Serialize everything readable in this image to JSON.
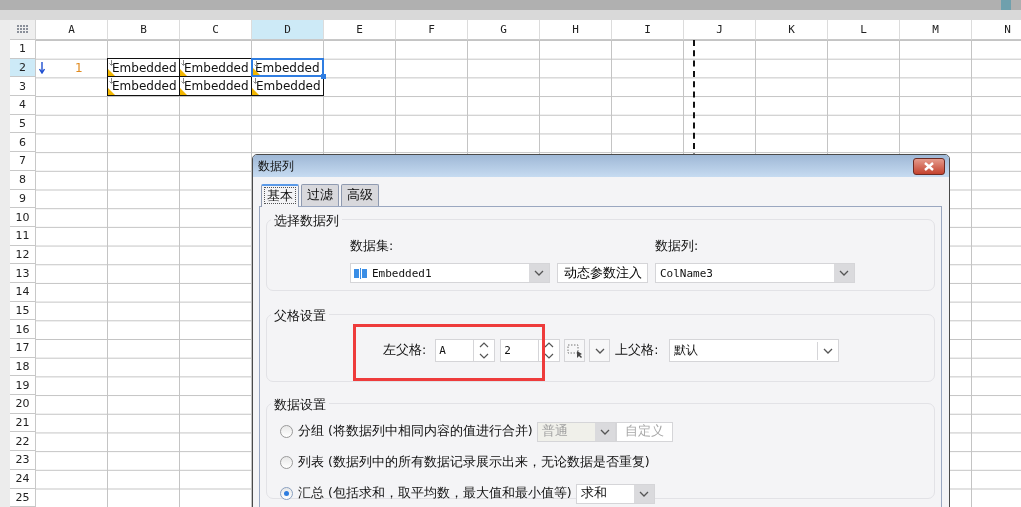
{
  "sheet": {
    "columns": [
      {
        "label": "A",
        "selected": false
      },
      {
        "label": "B",
        "selected": false
      },
      {
        "label": "C",
        "selected": false
      },
      {
        "label": "D",
        "selected": true
      },
      {
        "label": "E",
        "selected": false
      },
      {
        "label": "F",
        "selected": false
      },
      {
        "label": "G",
        "selected": false
      },
      {
        "label": "H",
        "selected": false
      },
      {
        "label": "I",
        "selected": false
      },
      {
        "label": "J",
        "selected": false
      },
      {
        "label": "K",
        "selected": false
      },
      {
        "label": "L",
        "selected": false
      },
      {
        "label": "M",
        "selected": false
      },
      {
        "label": "N",
        "selected": false
      }
    ],
    "rows": [
      {
        "label": "1",
        "selected": false
      },
      {
        "label": "2",
        "selected": true,
        "cells": [
          {
            "kind": "index",
            "text": "1"
          },
          {
            "kind": "embedded",
            "text": "Embedded",
            "selected": false
          },
          {
            "kind": "embedded",
            "text": "Embedded",
            "selected": false
          },
          {
            "kind": "embedded",
            "text": "Embedded",
            "selected": true
          }
        ]
      },
      {
        "label": "3",
        "selected": false,
        "cells": [
          {
            "kind": "empty"
          },
          {
            "kind": "embedded",
            "text": "Embedded",
            "selected": false
          },
          {
            "kind": "embedded",
            "text": "Embedded",
            "selected": false
          },
          {
            "kind": "embedded",
            "text": "Embedded",
            "selected": false
          }
        ]
      },
      {
        "label": "4",
        "selected": false
      },
      {
        "label": "5",
        "selected": false
      },
      {
        "label": "6",
        "selected": false
      },
      {
        "label": "7",
        "selected": false
      },
      {
        "label": "8",
        "selected": false
      },
      {
        "label": "9",
        "selected": false
      },
      {
        "label": "10",
        "selected": false
      },
      {
        "label": "11",
        "selected": false
      },
      {
        "label": "12",
        "selected": false
      },
      {
        "label": "13",
        "selected": false
      },
      {
        "label": "14",
        "selected": false
      },
      {
        "label": "15",
        "selected": false
      },
      {
        "label": "16",
        "selected": false
      },
      {
        "label": "17",
        "selected": false
      },
      {
        "label": "18",
        "selected": false
      },
      {
        "label": "19",
        "selected": false
      },
      {
        "label": "20",
        "selected": false
      },
      {
        "label": "21",
        "selected": false
      },
      {
        "label": "22",
        "selected": false
      },
      {
        "label": "23",
        "selected": false
      },
      {
        "label": "24",
        "selected": false
      },
      {
        "label": "25",
        "selected": false
      }
    ]
  },
  "dialog": {
    "title": "数据列",
    "tabs": [
      {
        "label": "基本",
        "selected": true
      },
      {
        "label": "过滤",
        "selected": false
      },
      {
        "label": "高级",
        "selected": false
      }
    ],
    "select_column": {
      "legend": "选择数据列",
      "dataset_label": "数据集:",
      "dataset": "Embedded1",
      "dynamic_button": "动态参数注入",
      "column_label": "数据列:",
      "column": "ColName3"
    },
    "parent_settings": {
      "legend": "父格设置",
      "highlighted": true,
      "left_label": "左父格:",
      "left_column": "A",
      "left_row": "2",
      "top_label": "上父格:",
      "top_value": "默认"
    },
    "data_settings": {
      "legend": "数据设置",
      "options": [
        {
          "label": "分组 (将数据列中相同内容的值进行合并)",
          "selected": false,
          "select": {
            "value": "普通",
            "disabled": true
          },
          "button": {
            "label": "自定义",
            "disabled": true
          }
        },
        {
          "label": "列表 (数据列中的所有数据记录展示出来，无论数据是否重复)",
          "selected": false
        },
        {
          "label": "汇总 (包括求和，取平均数，最大值和最小值等)",
          "selected": true,
          "select": {
            "value": "求和",
            "disabled": false
          }
        }
      ]
    }
  }
}
